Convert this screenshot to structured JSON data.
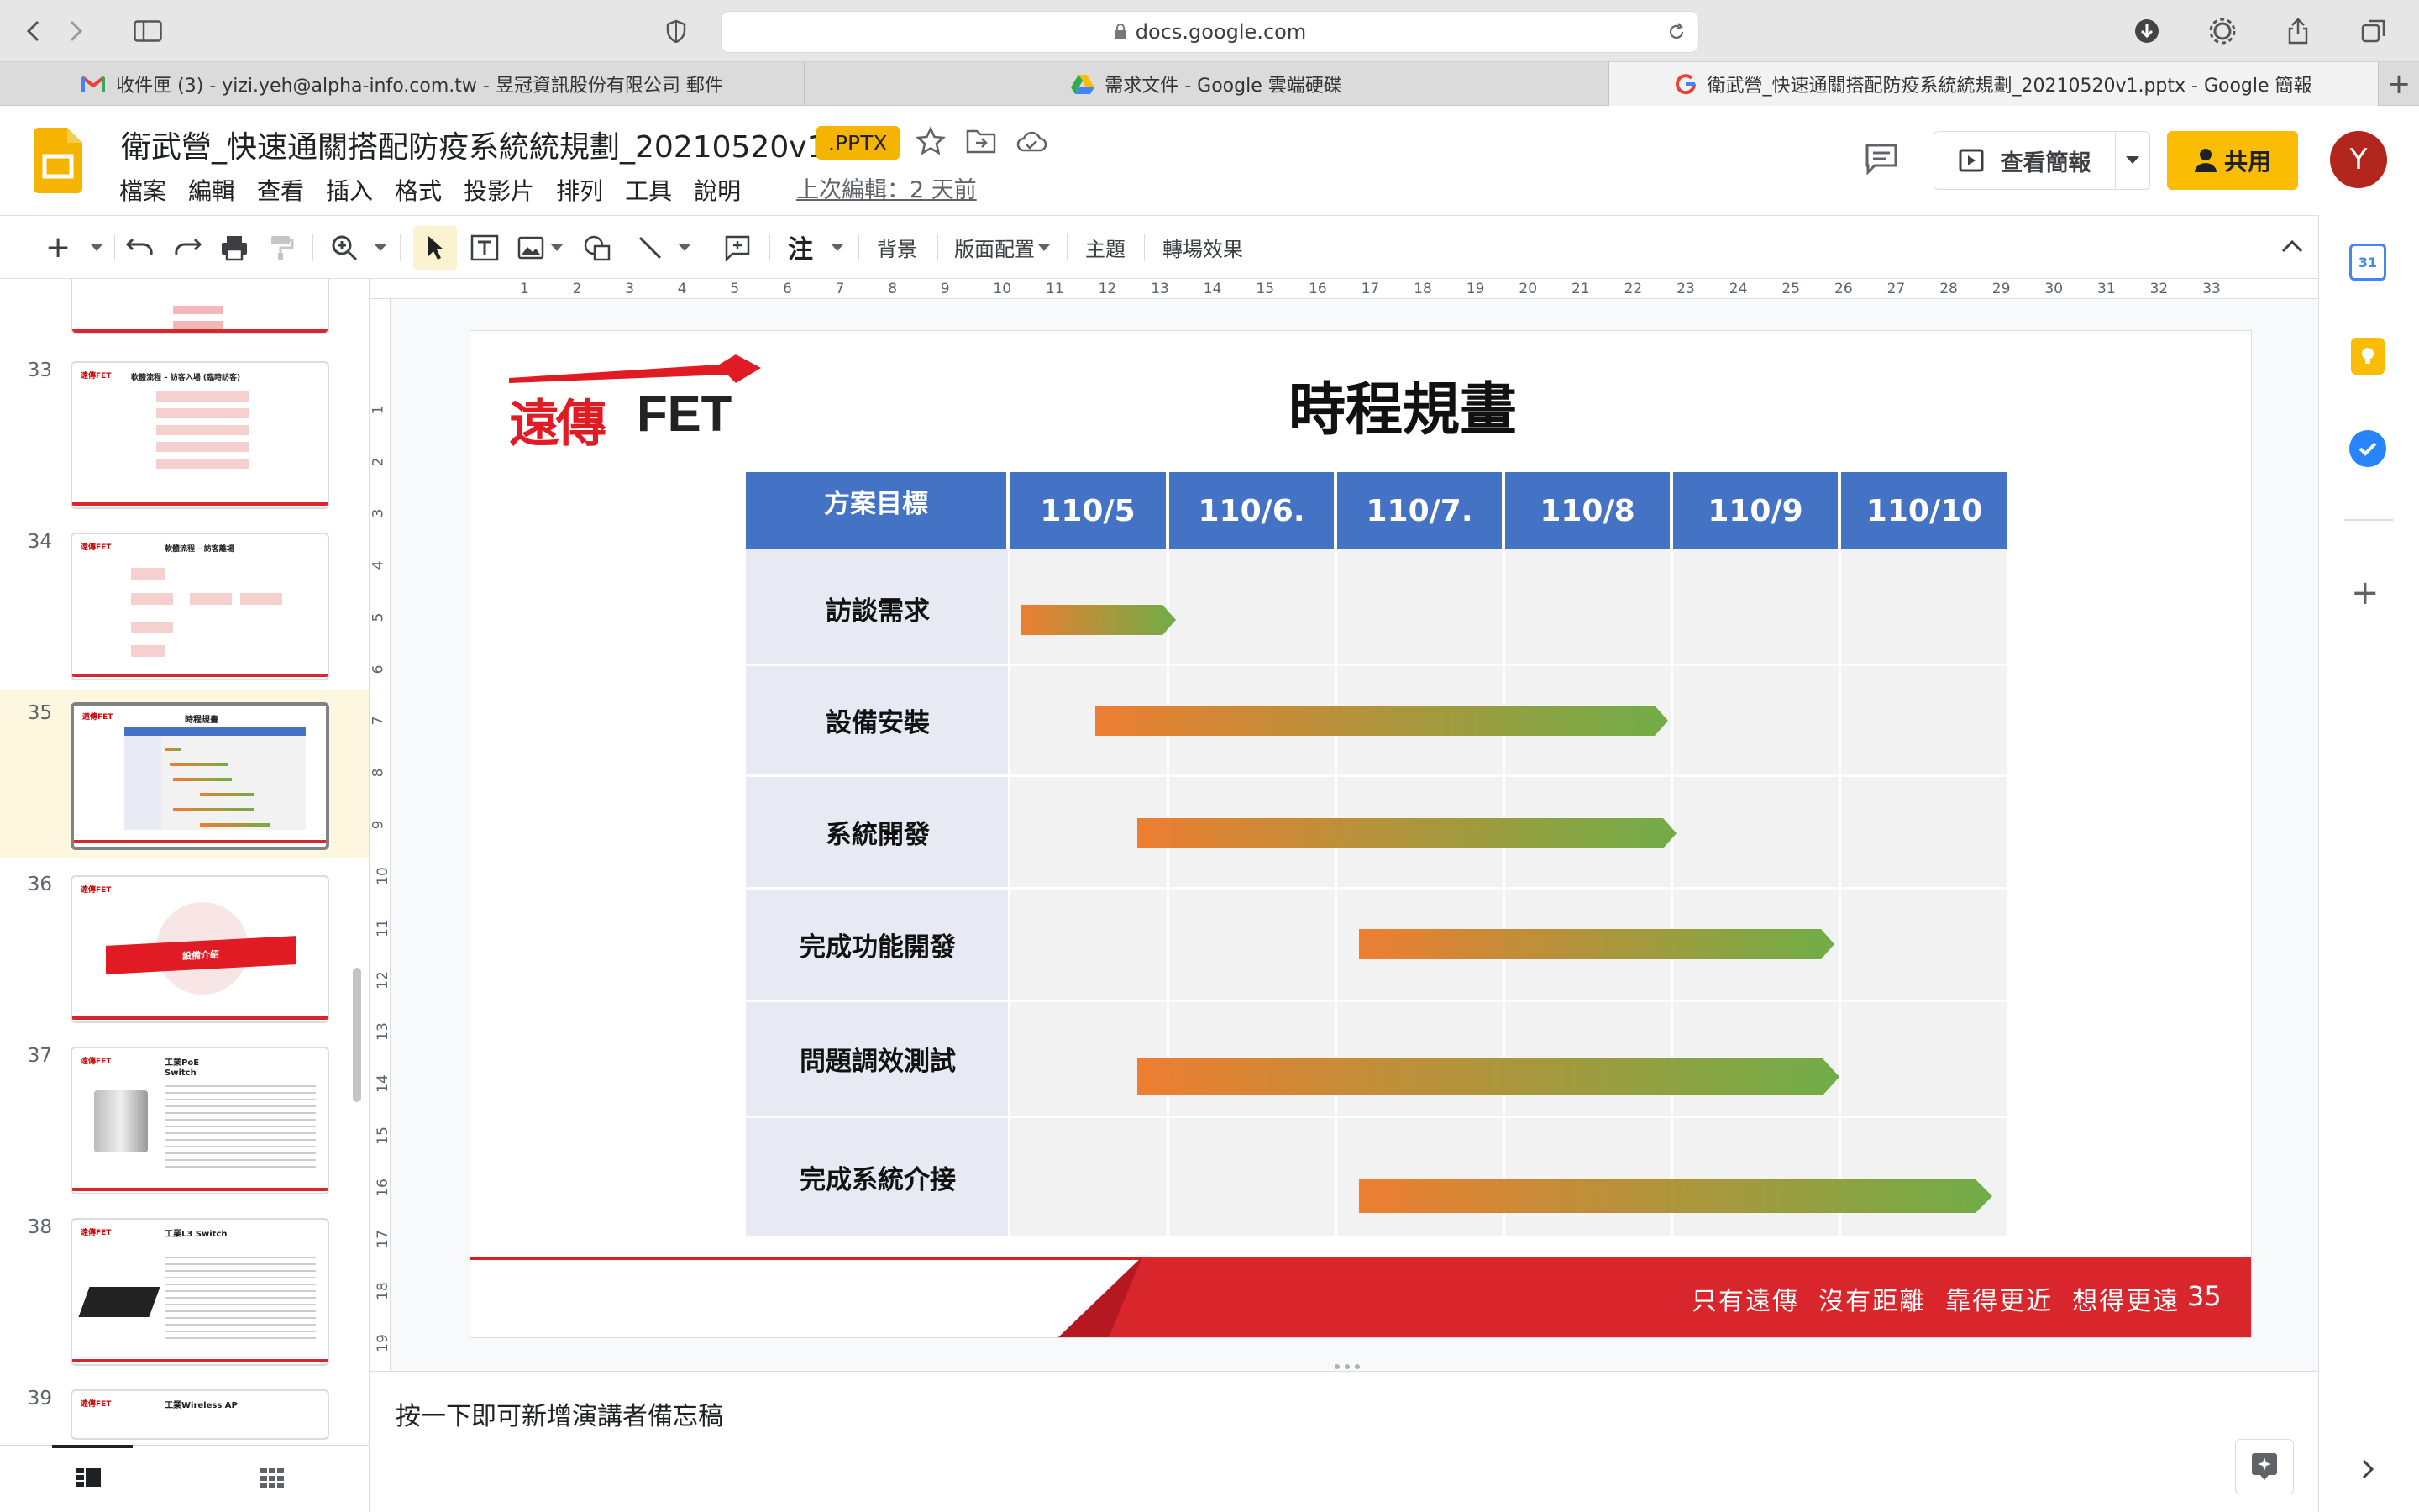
{
  "browser": {
    "url": "docs.google.com",
    "tabs": [
      {
        "label": "收件匣 (3) - yizi.yeh@alpha-info.com.tw - 昱冠資訊股份有限公司 郵件",
        "icon": "gmail-icon"
      },
      {
        "label": "需求文件 - Google 雲端硬碟",
        "icon": "drive-icon"
      },
      {
        "label": "衛武營_快速通關搭配防疫系統統規劃_20210520v1.pptx - Google 簡報",
        "icon": "google-icon"
      }
    ]
  },
  "doc": {
    "title": "衛武營_快速通關搭配防疫系統統規劃_20210520v1",
    "badge": ".PPTX",
    "menu": [
      "檔案",
      "編輯",
      "查看",
      "插入",
      "格式",
      "投影片",
      "排列",
      "工具",
      "說明"
    ],
    "last_edit": "上次編輯：2 天前",
    "present_label": "查看簡報",
    "share_label": "共用",
    "avatar_letter": "Y"
  },
  "toolbar": {
    "insert_text_label": "注",
    "background": "背景",
    "layout": "版面配置",
    "theme": "主題",
    "transition": "轉場效果"
  },
  "ruler": {
    "h_ticks": [
      "1",
      "2",
      "3",
      "4",
      "5",
      "6",
      "7",
      "8",
      "9",
      "10",
      "11",
      "12",
      "13",
      "14",
      "15",
      "16",
      "17",
      "18",
      "19",
      "20",
      "21",
      "22",
      "23",
      "24",
      "25",
      "26",
      "27",
      "28",
      "29",
      "30",
      "31",
      "32",
      "33"
    ],
    "v_ticks": [
      "1",
      "2",
      "3",
      "4",
      "5",
      "6",
      "7",
      "8",
      "9",
      "10",
      "11",
      "12",
      "13",
      "14",
      "15",
      "16",
      "17",
      "18",
      "19"
    ]
  },
  "filmstrip": [
    {
      "num": "33",
      "title": "軟體流程 – 訪客入場 (臨時訪客)"
    },
    {
      "num": "34",
      "title": "軟體流程 – 訪客離場"
    },
    {
      "num": "35",
      "title": "時程規畫",
      "selected": true
    },
    {
      "num": "36",
      "title": "設備介紹"
    },
    {
      "num": "37",
      "title": "工業PoE Switch"
    },
    {
      "num": "38",
      "title": "工業L3 Switch"
    },
    {
      "num": "39",
      "title": "工業Wireless AP"
    }
  ],
  "slide": {
    "logo_text": "FET",
    "logo_cjk": "遠傳",
    "title": "時程規畫",
    "table_header": "方案目標",
    "months": [
      "110/5",
      "110/6.",
      "110/7.",
      "110/8",
      "110/9",
      "110/10"
    ],
    "rows": [
      "訪談需求",
      "設備安裝",
      "系統開發",
      "完成功能開發",
      "問題調效測試",
      "完成系統介接"
    ],
    "footer_slogan": "只有遠傳  沒有距離  靠得更近  想得更遠",
    "page_number": "35",
    "colors": {
      "header_blue": "#4472c4",
      "bar_start": "#ed7d31",
      "bar_end": "#70ad47",
      "footer_red": "#d9262c"
    }
  },
  "notes": {
    "placeholder": "按一下即可新增演講者備忘稿"
  }
}
